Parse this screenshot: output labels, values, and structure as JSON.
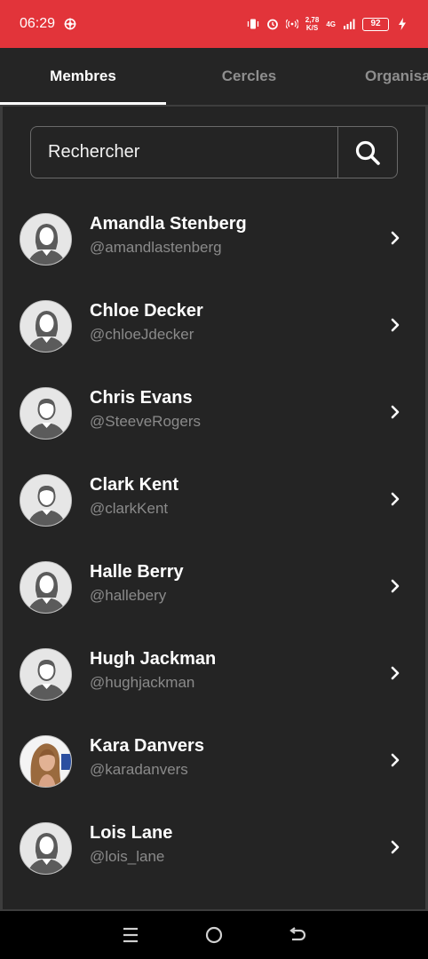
{
  "status_bar": {
    "time": "06:29",
    "network_speed_value": "2,78",
    "network_speed_unit": "K/S",
    "network_type": "4G",
    "battery": "92"
  },
  "tabs": [
    {
      "label": "Membres",
      "active": true
    },
    {
      "label": "Cercles",
      "active": false
    },
    {
      "label": "Organisa",
      "active": false
    }
  ],
  "search": {
    "placeholder": "Rechercher"
  },
  "members": [
    {
      "name": "Amandla Stenberg",
      "handle": "@amandlastenberg",
      "avatar": "female-default-avatar-icon"
    },
    {
      "name": "Chloe Decker",
      "handle": "@chloeJdecker",
      "avatar": "female-default-avatar-icon"
    },
    {
      "name": "Chris Evans",
      "handle": "@SteeveRogers",
      "avatar": "male-default-avatar-icon"
    },
    {
      "name": "Clark Kent",
      "handle": "@clarkKent",
      "avatar": "male-default-avatar-icon"
    },
    {
      "name": "Halle Berry",
      "handle": "@hallebery",
      "avatar": "female-default-avatar-icon"
    },
    {
      "name": "Hugh Jackman",
      "handle": "@hughjackman",
      "avatar": "male-default-avatar-icon"
    },
    {
      "name": "Kara Danvers",
      "handle": "@karadanvers",
      "avatar": "photo-avatar"
    },
    {
      "name": "Lois Lane",
      "handle": "@lois_lane",
      "avatar": "female-default-avatar-icon"
    }
  ],
  "colors": {
    "status_bar": "#e2343a",
    "background": "#242424",
    "tab_bar": "#252525",
    "handle_text": "#8a8a8a"
  }
}
